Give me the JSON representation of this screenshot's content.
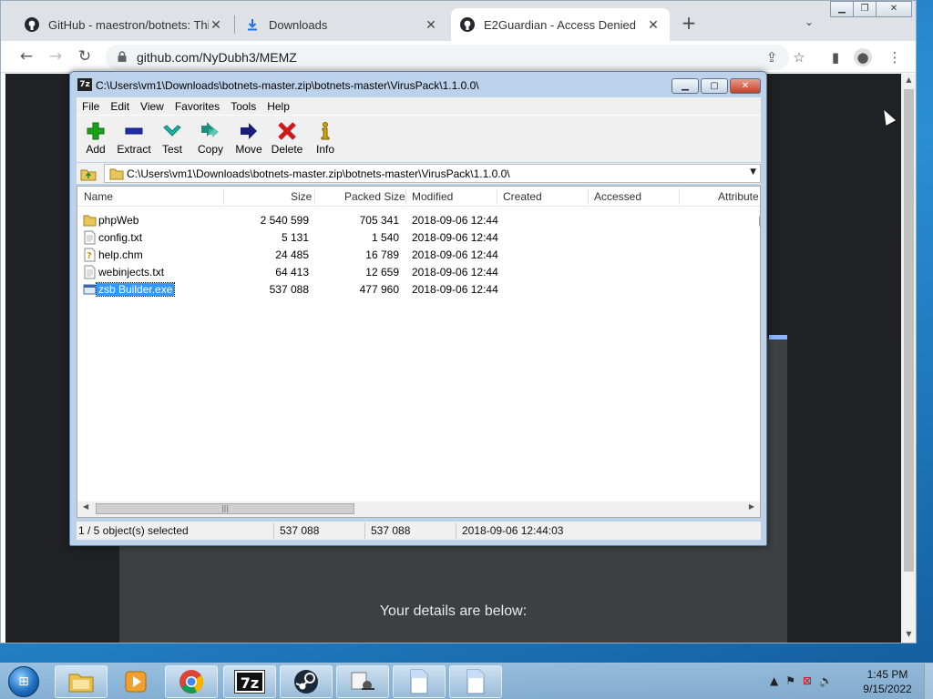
{
  "browser": {
    "tabs": [
      {
        "title": "GitHub - maestron/botnets: This",
        "icon": "github-icon"
      },
      {
        "title": "Downloads",
        "icon": "download-icon"
      },
      {
        "title": "E2Guardian - Access Denied",
        "icon": "github-icon"
      }
    ],
    "url": "github.com/NyDubh3/MEMZ",
    "page_text": "Your details are below:"
  },
  "sevenzip": {
    "title": "C:\\Users\\vm1\\Downloads\\botnets-master.zip\\botnets-master\\VirusPack\\1.1.0.0\\",
    "menu": [
      "File",
      "Edit",
      "View",
      "Favorites",
      "Tools",
      "Help"
    ],
    "tools": [
      {
        "label": "Add",
        "icon": "plus-icon",
        "color": "#1aa11a"
      },
      {
        "label": "Extract",
        "icon": "minus-icon",
        "color": "#1f2fa8"
      },
      {
        "label": "Test",
        "icon": "check-icon",
        "color": "#1bb3a8"
      },
      {
        "label": "Copy",
        "icon": "double-arrow-icon",
        "color": "#1a8f7c"
      },
      {
        "label": "Move",
        "icon": "arrow-right-icon",
        "color": "#1c1c7a"
      },
      {
        "label": "Delete",
        "icon": "x-icon",
        "color": "#d11818"
      },
      {
        "label": "Info",
        "icon": "info-icon",
        "color": "#d4a400"
      }
    ],
    "address": "C:\\Users\\vm1\\Downloads\\botnets-master.zip\\botnets-master\\VirusPack\\1.1.0.0\\",
    "columns": [
      "Name",
      "Size",
      "Packed Size",
      "Modified",
      "Created",
      "Accessed",
      "Attribute"
    ],
    "files": [
      {
        "name": "phpWeb",
        "size": "2 540 599",
        "packed": "705 341",
        "modified": "2018-09-06 12:44",
        "type": "folder"
      },
      {
        "name": "config.txt",
        "size": "5 131",
        "packed": "1 540",
        "modified": "2018-09-06 12:44",
        "type": "text"
      },
      {
        "name": "help.chm",
        "size": "24 485",
        "packed": "16 789",
        "modified": "2018-09-06 12:44",
        "type": "chm"
      },
      {
        "name": "webinjects.txt",
        "size": "64 413",
        "packed": "12 659",
        "modified": "2018-09-06 12:44",
        "type": "text"
      },
      {
        "name": "zsb Builder.exe",
        "size": "537 088",
        "packed": "477 960",
        "modified": "2018-09-06 12:44",
        "type": "exe"
      }
    ],
    "status": {
      "selection": "1 / 5 object(s) selected",
      "size": "537 088",
      "packed": "537 088",
      "modified": "2018-09-06 12:44:03"
    }
  },
  "taskbar": {
    "apps": [
      "explorer-icon",
      "media-player-icon",
      "chrome-icon",
      "sevenzip-icon",
      "steam-icon",
      "control-panel-icon",
      "notepad-icon",
      "notepad-icon"
    ],
    "sevenzip_label": "7z",
    "time": "1:45 PM",
    "date": "9/15/2022"
  }
}
